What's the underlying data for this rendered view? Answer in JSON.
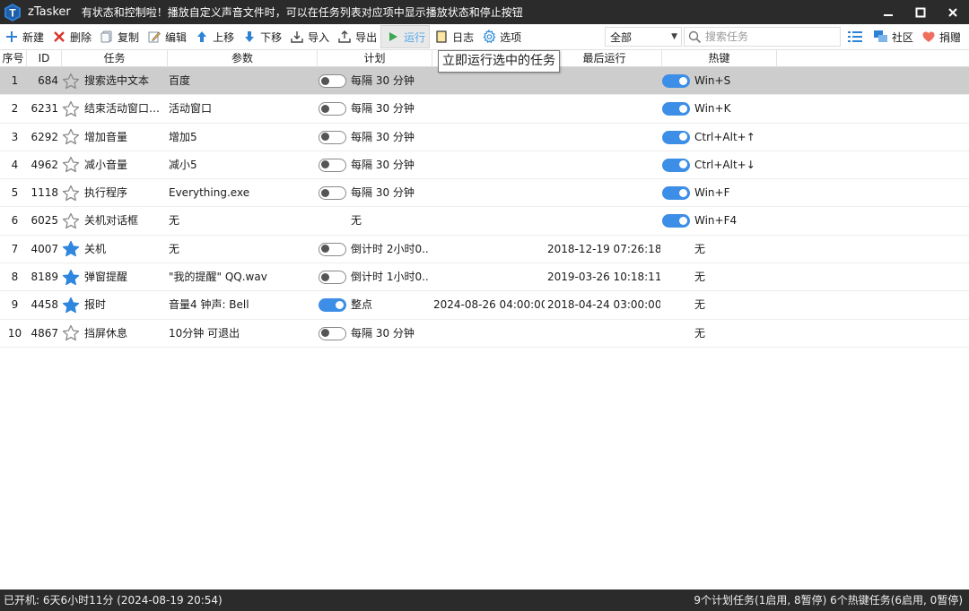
{
  "titlebar": {
    "app_name": "zTasker",
    "message": "有状态和控制啦！播放自定义声音文件时，可以在任务列表对应项中显示播放状态和停止按钮"
  },
  "toolbar": {
    "new": "新建",
    "delete": "删除",
    "copy": "复制",
    "edit": "编辑",
    "move_up": "上移",
    "move_down": "下移",
    "import": "导入",
    "export": "导出",
    "run": "运行",
    "log": "日志",
    "options": "选项",
    "filter_value": "全部",
    "search_placeholder": "搜索任务",
    "community": "社区",
    "donate": "捐赠"
  },
  "columns": {
    "seq": "序号",
    "id": "ID",
    "task": "任务",
    "param": "参数",
    "schedule": "计划",
    "next_run": "",
    "last_run": "最后运行",
    "hotkey": "热键"
  },
  "tooltip": "立即运行选中的任务",
  "rows": [
    {
      "seq": "1",
      "id": "684",
      "task": "搜索选中文本",
      "param": "百度",
      "sched_toggle": "off",
      "schedule": "每隔 30 分钟",
      "next": "",
      "last": "",
      "hk_toggle": "on",
      "hotkey": "Win+S",
      "star": "outline"
    },
    {
      "seq": "2",
      "id": "6231",
      "task": "结束活动窗口及...",
      "param": "活动窗口",
      "sched_toggle": "off",
      "schedule": "每隔 30 分钟",
      "next": "",
      "last": "",
      "hk_toggle": "on",
      "hotkey": "Win+K",
      "star": "outline"
    },
    {
      "seq": "3",
      "id": "6292",
      "task": "增加音量",
      "param": "增加5",
      "sched_toggle": "off",
      "schedule": "每隔 30 分钟",
      "next": "",
      "last": "",
      "hk_toggle": "on",
      "hotkey": "Ctrl+Alt+↑",
      "star": "outline"
    },
    {
      "seq": "4",
      "id": "4962",
      "task": "减小音量",
      "param": "减小5",
      "sched_toggle": "off",
      "schedule": "每隔 30 分钟",
      "next": "",
      "last": "",
      "hk_toggle": "on",
      "hotkey": "Ctrl+Alt+↓",
      "star": "outline"
    },
    {
      "seq": "5",
      "id": "1118",
      "task": "执行程序",
      "param": "Everything.exe",
      "sched_toggle": "off",
      "schedule": "每隔 30 分钟",
      "next": "",
      "last": "",
      "hk_toggle": "on",
      "hotkey": "Win+F",
      "star": "outline"
    },
    {
      "seq": "6",
      "id": "6025",
      "task": "关机对话框",
      "param": "无",
      "sched_toggle": "none",
      "schedule": "无",
      "next": "",
      "last": "",
      "hk_toggle": "on",
      "hotkey": "Win+F4",
      "star": "outline"
    },
    {
      "seq": "7",
      "id": "4007",
      "task": "关机",
      "param": "无",
      "sched_toggle": "off",
      "schedule": "倒计时 2小时0...",
      "next": "",
      "last": "2018-12-19 07:26:18",
      "hk_toggle": "none",
      "hotkey": "无",
      "star": "filled"
    },
    {
      "seq": "8",
      "id": "8189",
      "task": "弹窗提醒",
      "param": "\"我的提醒\" QQ.wav",
      "sched_toggle": "off",
      "schedule": "倒计时 1小时0...",
      "next": "",
      "last": "2019-03-26 10:18:11",
      "hk_toggle": "none",
      "hotkey": "无",
      "star": "filled"
    },
    {
      "seq": "9",
      "id": "4458",
      "task": "报时",
      "param": "音量4 钟声: Bell",
      "sched_toggle": "on",
      "schedule": "整点",
      "next": "2024-08-26 04:00:00",
      "last": "2018-04-24 03:00:00",
      "hk_toggle": "none",
      "hotkey": "无",
      "star": "filled"
    },
    {
      "seq": "10",
      "id": "4867",
      "task": "挡屏休息",
      "param": "10分钟 可退出",
      "sched_toggle": "off",
      "schedule": "每隔 30 分钟",
      "next": "",
      "last": "",
      "hk_toggle": "none",
      "hotkey": "无",
      "star": "outline"
    }
  ],
  "selected_row": 0,
  "statusbar": {
    "uptime": "已开机:  6天6小时11分 (2024-08-19 20:54)",
    "summary": "9个计划任务(1启用, 8暂停)  6个热键任务(6启用, 0暂停)"
  },
  "colors": {
    "accent": "#3d8ee6",
    "titlebar_bg": "#2b2b2b",
    "selected_row": "#cdcdcd"
  }
}
